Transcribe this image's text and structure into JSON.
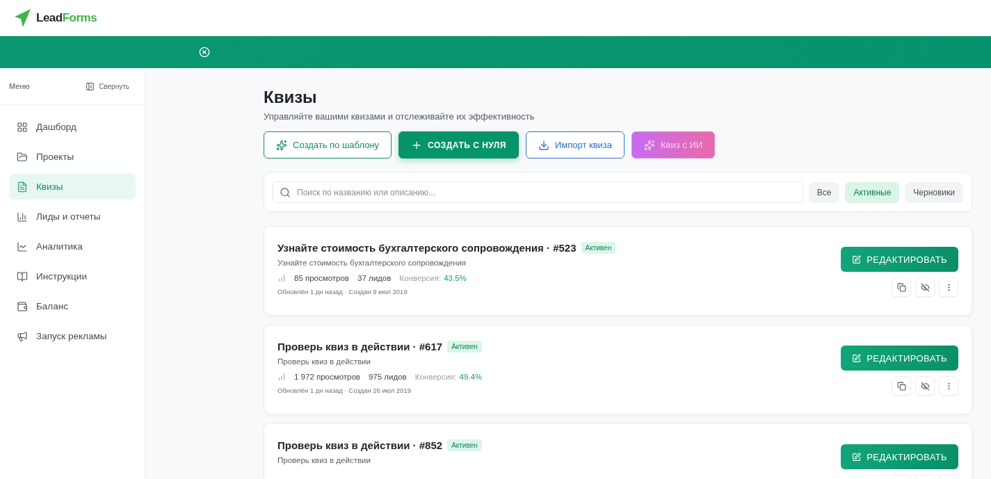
{
  "logo": {
    "part1": "Lead",
    "part2": "Forms"
  },
  "sidebar": {
    "title": "Меню",
    "collapse": "Свернуть",
    "items": [
      {
        "label": "Дашборд",
        "selected": false
      },
      {
        "label": "Проекты",
        "selected": false
      },
      {
        "label": "Квизы",
        "selected": true
      },
      {
        "label": "Лиды и отчеты",
        "selected": false
      },
      {
        "label": "Аналитика",
        "selected": false
      },
      {
        "label": "Инструкции",
        "selected": false
      },
      {
        "label": "Баланс",
        "selected": false
      },
      {
        "label": "Запуск рекламы",
        "selected": false
      }
    ]
  },
  "page": {
    "title": "Квизы",
    "subtitle": "Управляйте вашими квизами и отслеживайте их эффективность"
  },
  "actions": [
    {
      "kind": "outline",
      "label": "Создать по шаблону"
    },
    {
      "kind": "primary",
      "label": "СОЗДАТЬ С НУЛЯ"
    },
    {
      "kind": "blue",
      "label": "Импорт квиза"
    },
    {
      "kind": "ai",
      "label": "Квиз с ИИ"
    }
  ],
  "search": {
    "placeholder": "Поиск по названию или описанию..."
  },
  "filters": [
    {
      "label": "Все",
      "selected": false
    },
    {
      "label": "Активные",
      "selected": true
    },
    {
      "label": "Черновики",
      "selected": false
    }
  ],
  "quizzes": [
    {
      "title": "Узнайте стоимость бухгалтерского сопровождения · #523",
      "status": "Активен",
      "description": "Узнайте стоимость бухгалтерского сопровождения",
      "views": "85 просмотров",
      "leads": "37 лидов",
      "conversion_label": "Конверсия:",
      "conversion": "43.5%",
      "dates": "Обновлён 1 дн назад · Создан 9 июл 2019",
      "edit": "РЕДАКТИРОВАТЬ"
    },
    {
      "title": "Проверь квиз в действии · #617",
      "status": "Активен",
      "description": "Проверь квиз в действии",
      "views": "1 972 просмотров",
      "leads": "975 лидов",
      "conversion_label": "Конверсия:",
      "conversion": "49.4%",
      "dates": "Обновлён 1 дн назад · Создан 26 июл 2019",
      "edit": "РЕДАКТИРОВАТЬ"
    },
    {
      "title": "Проверь квиз в действии · #852",
      "status": "Активен",
      "description": "Проверь квиз в действии",
      "edit": "РЕДАКТИРОВАТЬ"
    }
  ]
}
